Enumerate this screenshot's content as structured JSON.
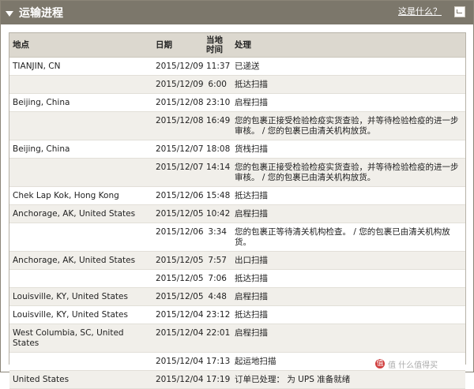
{
  "header": {
    "title": "运输进程",
    "help_link": "这是什么？",
    "collapse_icon": "triangle-down-icon",
    "help_icon": "help-popup-icon"
  },
  "table": {
    "columns": [
      "地点",
      "日期",
      "当地时间",
      "处理"
    ],
    "rows": [
      {
        "location": "TIANJIN, CN",
        "date": "2015/12/09",
        "time": "11:37",
        "activity": "已递送"
      },
      {
        "location": "",
        "date": "2015/12/09",
        "time": "6:00",
        "activity": "抵达扫描"
      },
      {
        "location": "Beijing, China",
        "date": "2015/12/08",
        "time": "23:10",
        "activity": "启程扫描"
      },
      {
        "location": "",
        "date": "2015/12/08",
        "time": "16:49",
        "activity": "您的包裹正接受检验检疫实货查验，并等待检验检疫的进一步审核。 / 您的包裹已由清关机构放货。"
      },
      {
        "location": "Beijing, China",
        "date": "2015/12/07",
        "time": "18:08",
        "activity": "货栈扫描"
      },
      {
        "location": "",
        "date": "2015/12/07",
        "time": "14:14",
        "activity": "您的包裹正接受检验检疫实货查验，并等待检验检疫的进一步审核。 / 您的包裹已由清关机构放货。"
      },
      {
        "location": "Chek Lap Kok, Hong Kong",
        "date": "2015/12/06",
        "time": "15:48",
        "activity": "抵达扫描"
      },
      {
        "location": "Anchorage, AK, United States",
        "date": "2015/12/05",
        "time": "10:42",
        "activity": "启程扫描"
      },
      {
        "location": "",
        "date": "2015/12/06",
        "time": "3:34",
        "activity": "您的包裹正等待清关机构检查。 / 您的包裹已由清关机构放货。"
      },
      {
        "location": "Anchorage, AK, United States",
        "date": "2015/12/05",
        "time": "7:57",
        "activity": "出口扫描"
      },
      {
        "location": "",
        "date": "2015/12/05",
        "time": "7:06",
        "activity": "抵达扫描"
      },
      {
        "location": "Louisville, KY, United States",
        "date": "2015/12/05",
        "time": "4:48",
        "activity": "启程扫描"
      },
      {
        "location": "Louisville, KY, United States",
        "date": "2015/12/04",
        "time": "23:12",
        "activity": "抵达扫描"
      },
      {
        "location": "West Columbia, SC, United States",
        "date": "2015/12/04",
        "time": "22:01",
        "activity": "启程扫描"
      },
      {
        "location": "",
        "date": "2015/12/04",
        "time": "17:13",
        "activity": "起运地扫描"
      },
      {
        "location": "United States",
        "date": "2015/12/04",
        "time": "17:19",
        "activity": "订单已处理： 为 UPS 准备就绪"
      }
    ]
  },
  "watermark": {
    "text": "值 什么值得买",
    "icon": "zhi-logo-icon"
  }
}
